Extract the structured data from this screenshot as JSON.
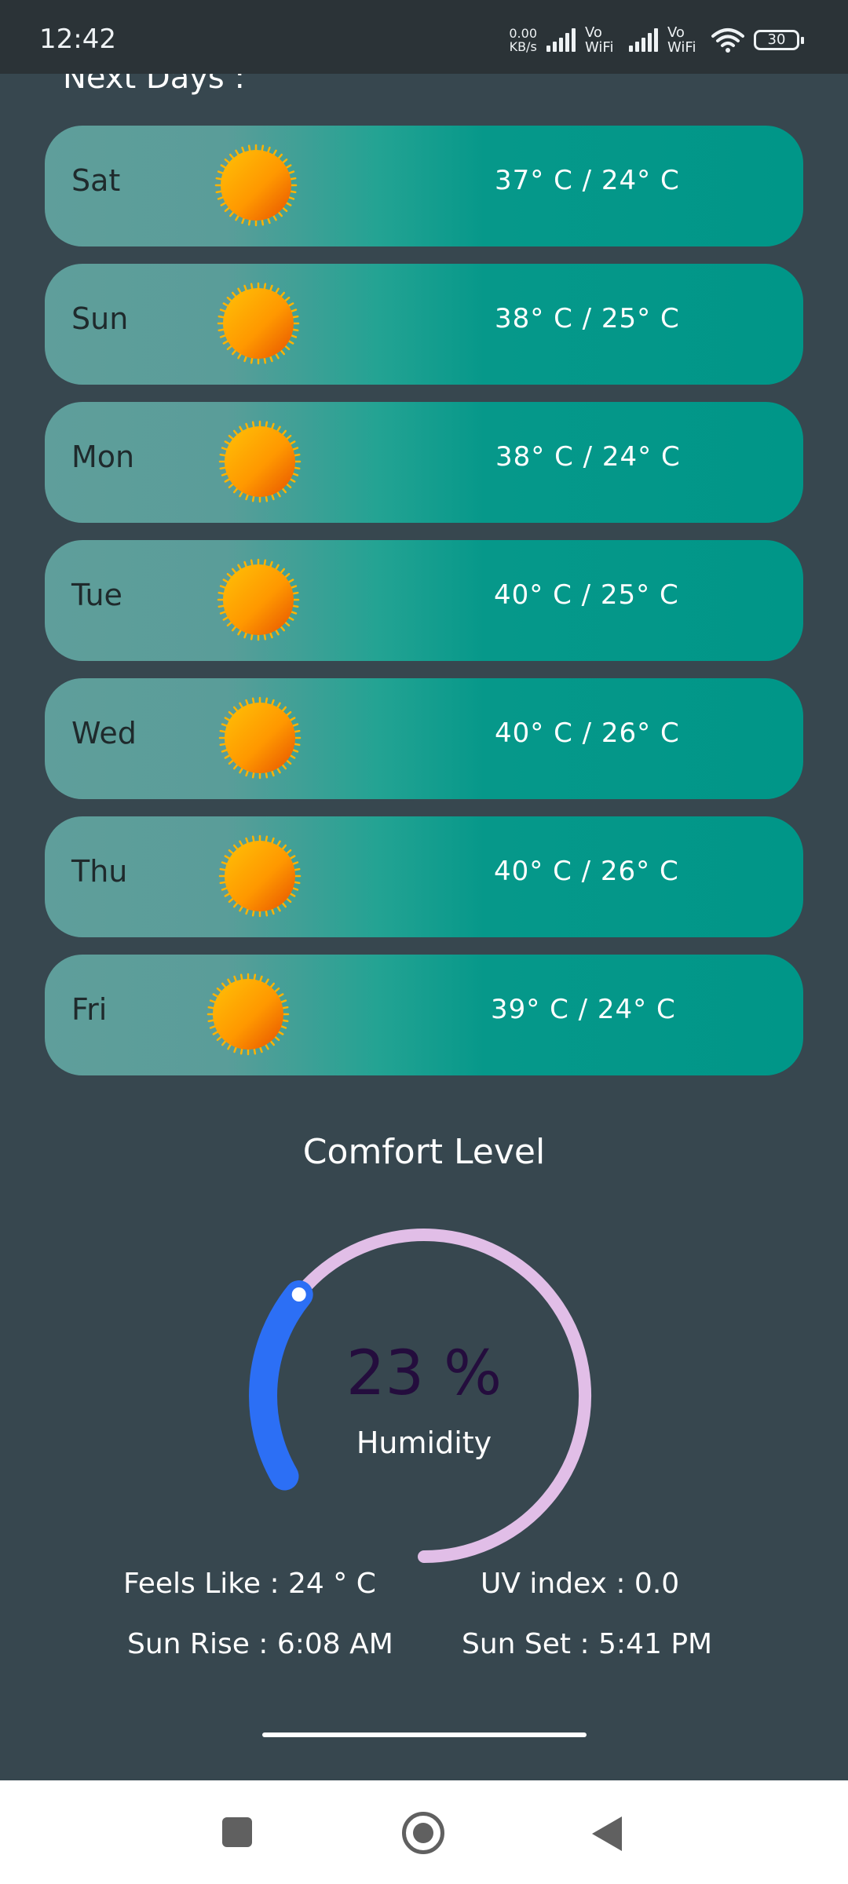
{
  "status_bar": {
    "time": "12:42",
    "net_speed_value": "0.00",
    "net_speed_unit": "KB/s",
    "sim1_label": "Vo WiFi",
    "sim2_label": "Vo WiFi",
    "battery": "30"
  },
  "next_days": {
    "title": "Next Days :",
    "days": [
      {
        "day": "Sat",
        "temps": "37° C / 24° C",
        "icon": "sun-icon"
      },
      {
        "day": "Sun",
        "temps": "38° C / 25° C",
        "icon": "sun-icon"
      },
      {
        "day": "Mon",
        "temps": "38° C / 24° C",
        "icon": "sun-icon"
      },
      {
        "day": "Tue",
        "temps": "40° C / 25° C",
        "icon": "sun-icon"
      },
      {
        "day": "Wed",
        "temps": "40° C / 26° C",
        "icon": "sun-icon"
      },
      {
        "day": "Thu",
        "temps": "40° C / 26° C",
        "icon": "sun-icon"
      },
      {
        "day": "Fri",
        "temps": "39° C / 24° C",
        "icon": "sun-icon"
      }
    ]
  },
  "comfort": {
    "title": "Comfort Level",
    "value": "23 %",
    "label": "Humidity",
    "humidity_fraction": 0.23,
    "track_color": "#e1bee7",
    "progress_color": "#2c6ff5"
  },
  "details": {
    "feels_like": "Feels Like : 24 ° C",
    "uv_index": "UV index : 0.0",
    "sun_rise": "Sun Rise : 6:08 AM",
    "sun_set": "Sun Set : 5:41 PM"
  },
  "colors": {
    "background": "#37474f",
    "card": "#009688"
  }
}
